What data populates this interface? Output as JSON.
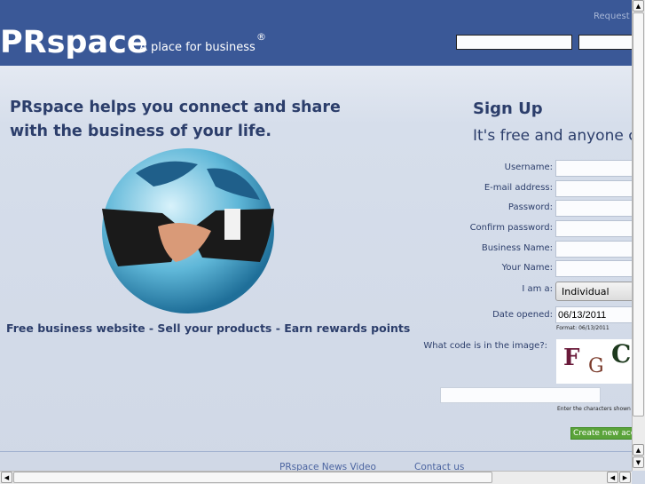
{
  "header": {
    "logo": "PRspace",
    "tagline": "A place for business",
    "registered": "®",
    "request_link": "Request n"
  },
  "intro": {
    "headline": "PRspace helps you connect and share with the business of your life.",
    "features": "Free business website - Sell your products - Earn rewards points"
  },
  "signup": {
    "title": "Sign Up",
    "subtitle": "It's free and anyone can",
    "fields": [
      {
        "label": "Username:",
        "value": ""
      },
      {
        "label": "E-mail address:",
        "value": ""
      },
      {
        "label": "Password:",
        "value": ""
      },
      {
        "label": "Confirm password:",
        "value": ""
      },
      {
        "label": "Business Name:",
        "value": ""
      },
      {
        "label": "Your Name:",
        "value": ""
      }
    ],
    "iam_label": "I am a:",
    "iam_value": "Individual",
    "date_label": "Date opened:",
    "date_value": "06/13/2011",
    "date_format": "Format: 06/13/2011",
    "captcha_label": "What code is in the image?:",
    "captcha_text": "FGC",
    "captcha_hint": "Enter the characters shown",
    "create_button": "Create new account"
  },
  "footer": {
    "links": [
      "PRspace News Video",
      "Contact us"
    ]
  }
}
